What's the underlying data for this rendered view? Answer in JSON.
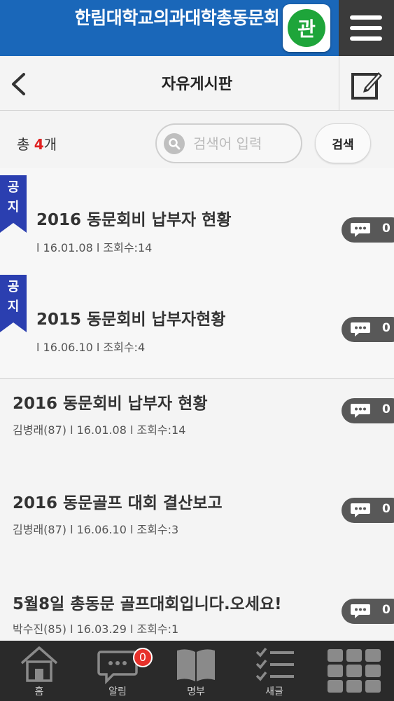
{
  "header": {
    "title": "한림대학교의과대학총동문회",
    "badge": "관"
  },
  "subheader": {
    "title": "자유게시판"
  },
  "search": {
    "count_prefix": "총",
    "count": "4",
    "count_suffix": "개",
    "placeholder": "검색어 입력",
    "button": "검색"
  },
  "notice_label": "공지",
  "posts": [
    {
      "title": "2016 동문회비 납부자 현황",
      "meta": "l 16.01.08 l 조회수:14",
      "comments": "0",
      "notice": true
    },
    {
      "title": "2015 동문회비 납부자현황",
      "meta": "l 16.06.10 l 조회수:4",
      "comments": "0",
      "notice": true
    },
    {
      "title": "2016 동문회비 납부자 현황",
      "meta": "김병래(87) l 16.01.08 l 조회수:14",
      "comments": "0",
      "notice": false
    },
    {
      "title": "2016 동문골프 대회 결산보고",
      "meta": "김병래(87) l 16.06.10 l 조회수:3",
      "comments": "0",
      "notice": false
    },
    {
      "title": "5월8일 총동문 골프대회입니다.오세요!",
      "meta": "박수진(85) l 16.03.29 l 조회수:1",
      "comments": "0",
      "notice": false
    }
  ],
  "bottom_nav": {
    "home": "홈",
    "alerts": "알림",
    "alerts_badge": "0",
    "directory": "명부",
    "new": "새글",
    "more": ""
  },
  "colors": {
    "header_blue": "#1a67b9",
    "badge_green": "#1ea53a",
    "notice_ribbon": "#2b3fb0",
    "count_red": "#e02020"
  },
  "icons": {
    "menu": "hamburger-icon",
    "back": "chevron-left-icon",
    "write": "edit-icon",
    "search": "search-icon",
    "comment": "speech-bubble-icon"
  }
}
